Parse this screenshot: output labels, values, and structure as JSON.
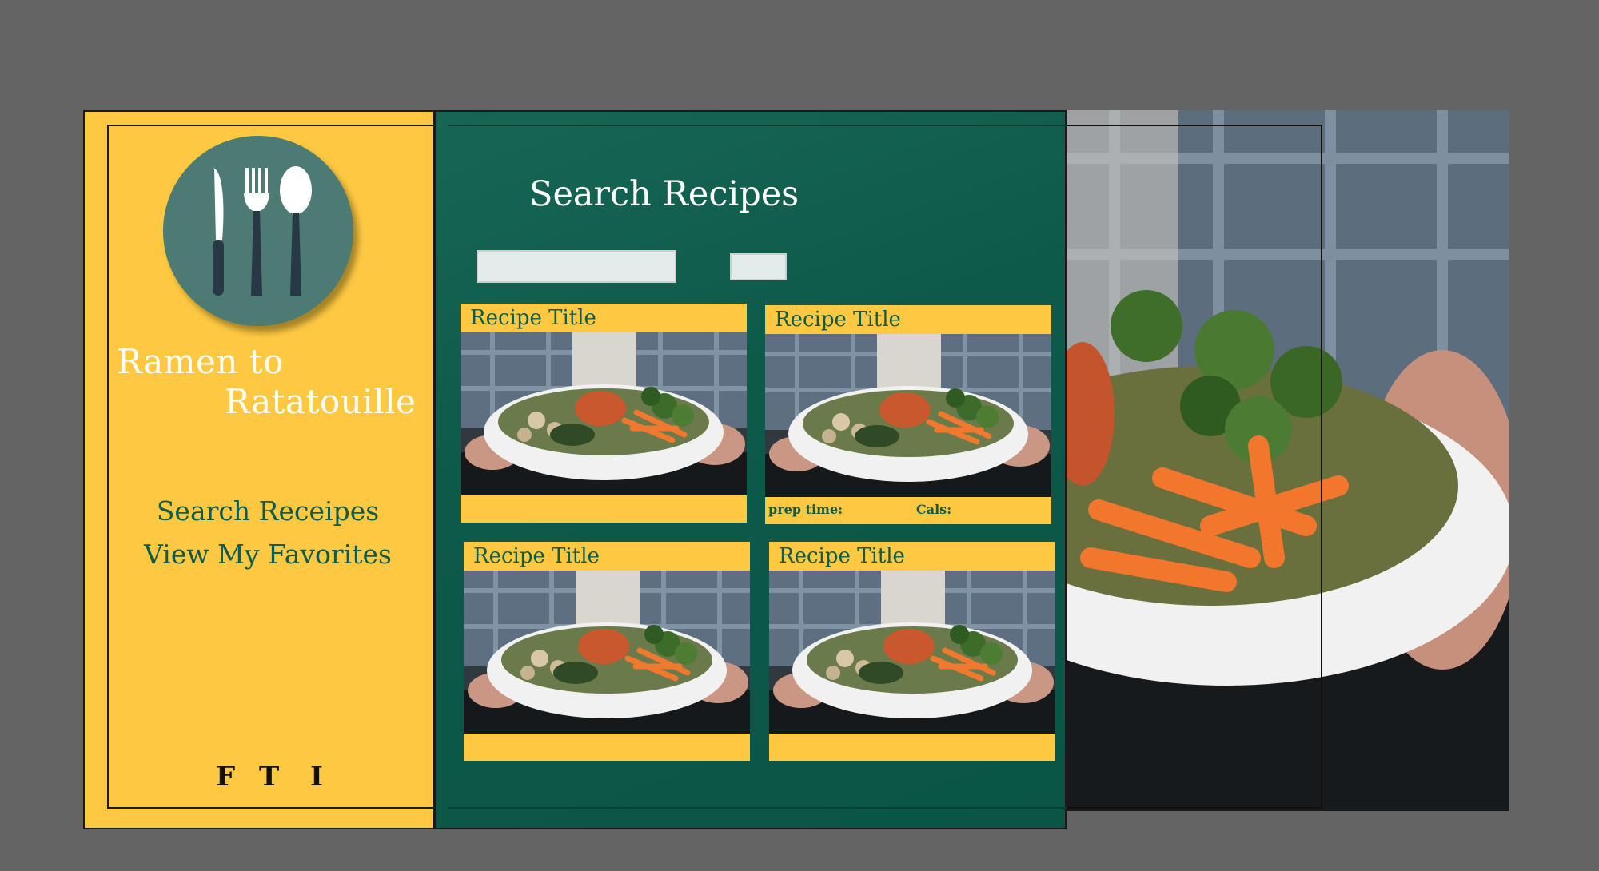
{
  "brand": {
    "line1": "Ramen to",
    "line2": "Ratatouille"
  },
  "logo": {
    "icons": [
      "knife-icon",
      "fork-icon",
      "spoon-icon"
    ],
    "background": "#4b7b72"
  },
  "nav": {
    "search": "Search Receipes",
    "favorites": "View My Favorites"
  },
  "social": {
    "facebook": "F",
    "twitter": "T",
    "instagram": "I"
  },
  "main": {
    "title": "Search Recipes",
    "search_input_value": "",
    "search_button_label": ""
  },
  "cards": [
    {
      "title": "Recipe Title",
      "prep_label": "",
      "cals_label": ""
    },
    {
      "title": "Recipe Title",
      "prep_label": "prep time:",
      "cals_label": "Cals:"
    },
    {
      "title": "Recipe Title",
      "prep_label": "",
      "cals_label": ""
    },
    {
      "title": "Recipe Title",
      "prep_label": "",
      "cals_label": ""
    }
  ],
  "colors": {
    "sidebar": "#fec940",
    "main_panel": "#0e5a4a",
    "accent_text": "#0f5b4c",
    "canvas": "#646464"
  }
}
